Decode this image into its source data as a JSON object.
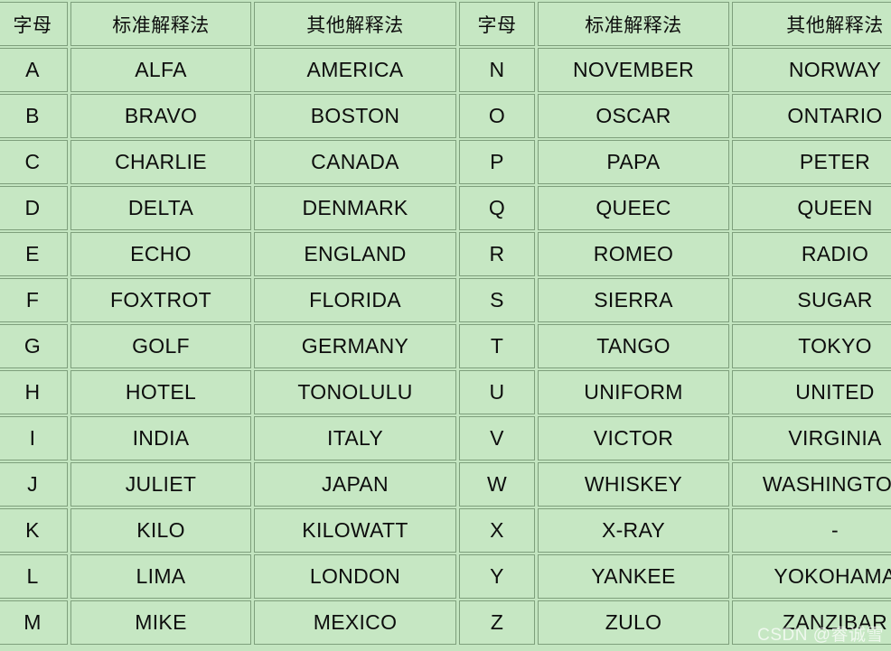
{
  "table": {
    "headers": {
      "letter": "字母",
      "standard": "标准解释法",
      "other": "其他解释法"
    },
    "left_rows": [
      {
        "letter": "A",
        "standard": "ALFA",
        "other": "AMERICA"
      },
      {
        "letter": "B",
        "standard": "BRAVO",
        "other": "BOSTON"
      },
      {
        "letter": "C",
        "standard": "CHARLIE",
        "other": "CANADA"
      },
      {
        "letter": "D",
        "standard": "DELTA",
        "other": "DENMARK"
      },
      {
        "letter": "E",
        "standard": "ECHO",
        "other": "ENGLAND"
      },
      {
        "letter": "F",
        "standard": "FOXTROT",
        "other": "FLORIDA"
      },
      {
        "letter": "G",
        "standard": "GOLF",
        "other": "GERMANY"
      },
      {
        "letter": "H",
        "standard": "HOTEL",
        "other": "TONOLULU"
      },
      {
        "letter": "I",
        "standard": "INDIA",
        "other": "ITALY"
      },
      {
        "letter": "J",
        "standard": "JULIET",
        "other": "JAPAN"
      },
      {
        "letter": "K",
        "standard": "KILO",
        "other": "KILOWATT"
      },
      {
        "letter": "L",
        "standard": "LIMA",
        "other": "LONDON"
      },
      {
        "letter": "M",
        "standard": "MIKE",
        "other": "MEXICO"
      }
    ],
    "right_rows": [
      {
        "letter": "N",
        "standard": "NOVEMBER",
        "other": "NORWAY"
      },
      {
        "letter": "O",
        "standard": "OSCAR",
        "other": "ONTARIO"
      },
      {
        "letter": "P",
        "standard": "PAPA",
        "other": "PETER"
      },
      {
        "letter": "Q",
        "standard": "QUEEC",
        "other": "QUEEN"
      },
      {
        "letter": "R",
        "standard": "ROMEO",
        "other": "RADIO"
      },
      {
        "letter": "S",
        "standard": "SIERRA",
        "other": "SUGAR"
      },
      {
        "letter": "T",
        "standard": "TANGO",
        "other": "TOKYO"
      },
      {
        "letter": "U",
        "standard": "UNIFORM",
        "other": "UNITED"
      },
      {
        "letter": "V",
        "standard": "VICTOR",
        "other": "VIRGINIA"
      },
      {
        "letter": "W",
        "standard": "WHISKEY",
        "other": "WASHINGTON"
      },
      {
        "letter": "X",
        "standard": "X-RAY",
        "other": "-"
      },
      {
        "letter": "Y",
        "standard": "YANKEE",
        "other": "YOKOHAMA"
      },
      {
        "letter": "Z",
        "standard": "ZULO",
        "other": "ZANZIBAR"
      }
    ]
  },
  "watermark": {
    "text": "CSDN @睿诚雪"
  },
  "colors": {
    "cell_background": "#c6e7c3",
    "page_background": "#c3e5c0",
    "cell_border": "#7e9f7c",
    "text": "#0d0d0d",
    "watermark_text": "#ffffff"
  }
}
